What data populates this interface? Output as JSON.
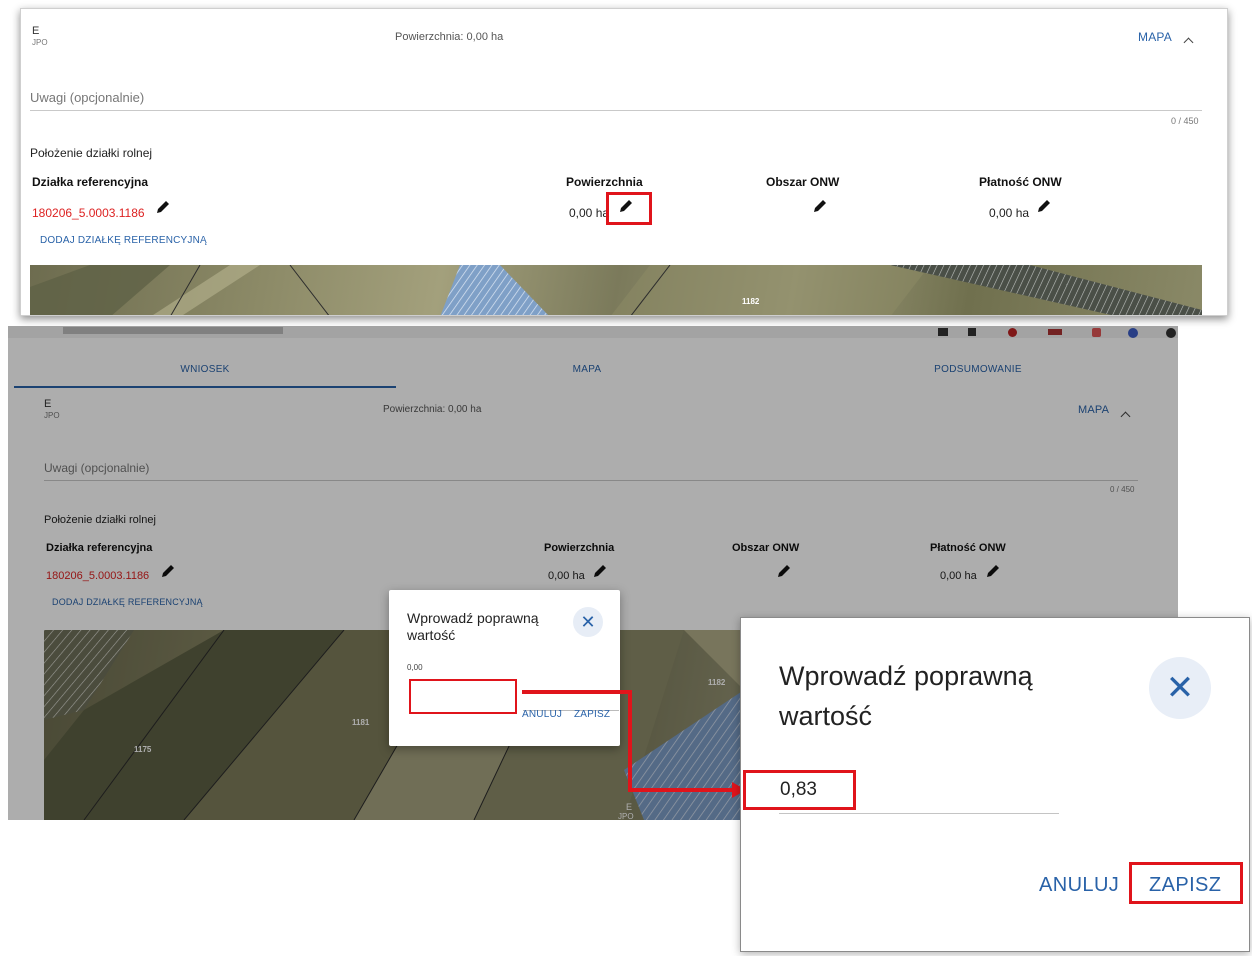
{
  "panel1": {
    "parcel_code": "E",
    "parcel_sub": "JPO",
    "area_summary": "Powierzchnia: 0,00 ha",
    "map_link": "MAPA",
    "notes_placeholder": "Uwagi (opcjonalnie)",
    "notes_counter": "0 / 450",
    "section_title": "Położenie działki rolnej",
    "columns": [
      "Działka referencyjna",
      "Powierzchnia",
      "Obszar ONW",
      "Płatność ONW"
    ],
    "ref_parcel": "180206_5.0003.1186",
    "area_value": "0,00 ha",
    "payment_value": "0,00 ha",
    "add_ref_link": "DODAJ DZIAŁKĘ REFERENCYJNĄ",
    "map_label": "1182"
  },
  "panel2": {
    "tabs": [
      "WNIOSEK",
      "MAPA",
      "PODSUMOWANIE"
    ],
    "parcel_code": "E",
    "parcel_sub": "JPO",
    "area_summary": "Powierzchnia: 0,00 ha",
    "map_link": "MAPA",
    "notes_placeholder": "Uwagi (opcjonalnie)",
    "notes_counter": "0 / 450",
    "section_title": "Położenie działki rolnej",
    "columns": [
      "Działka referencyjna",
      "Powierzchnia",
      "Obszar ONW",
      "Płatność ONW"
    ],
    "ref_parcel": "180206_5.0003.1186",
    "area_value": "0,00 ha",
    "payment_value": "0,00 ha",
    "add_ref_link": "DODAJ DZIAŁKĘ REFERENCYJNĄ",
    "map_labels": [
      "1175",
      "1181",
      "1182",
      "E",
      "JPO"
    ]
  },
  "dialog_small": {
    "title": "Wprowadź poprawną wartość",
    "value_label": "0,00",
    "input_value": "",
    "cancel": "ANULUJ",
    "save": "ZAPISZ"
  },
  "dialog_big": {
    "title": "Wprowadź poprawną wartość",
    "input_value": "0,83",
    "cancel": "ANULUJ",
    "save": "ZAPISZ"
  },
  "colors": {
    "accent": "#2962a8",
    "highlight": "#e0141b",
    "ref_parcel": "#dd2222"
  }
}
